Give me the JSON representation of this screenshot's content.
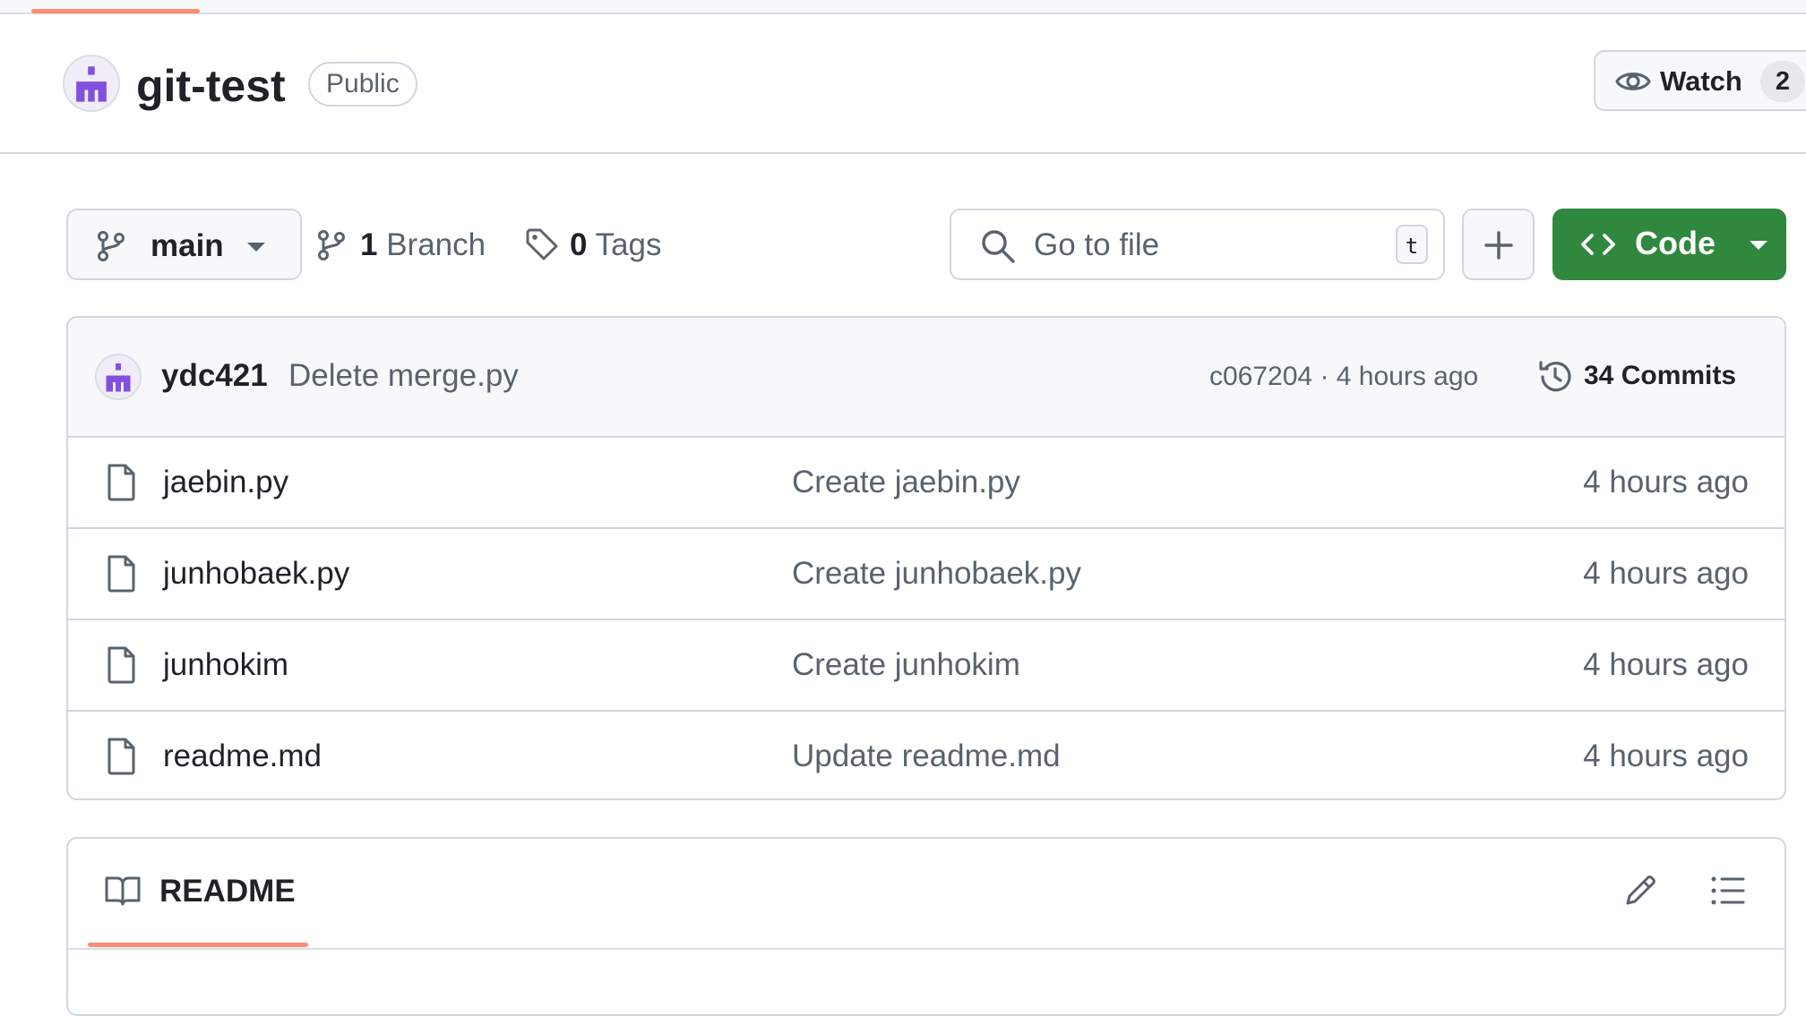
{
  "repo": {
    "name": "git-test",
    "visibility": "Public",
    "watch_label": "Watch",
    "watch_count": "2"
  },
  "toolbar": {
    "branch_name": "main",
    "branches_count": "1",
    "branches_label": "Branch",
    "tags_count": "0",
    "tags_label": "Tags",
    "search_placeholder": "Go to file",
    "search_shortcut": "t",
    "code_label": "Code"
  },
  "latest_commit": {
    "author": "ydc421",
    "message": "Delete merge.py",
    "sha_time": "c067204 · 4 hours ago",
    "commits_label": "34 Commits"
  },
  "files": [
    {
      "name": "jaebin.py",
      "commit_message": "Create jaebin.py",
      "age": "4 hours ago"
    },
    {
      "name": "junhobaek.py",
      "commit_message": "Create junhobaek.py",
      "age": "4 hours ago"
    },
    {
      "name": "junhokim",
      "commit_message": "Create junhokim",
      "age": "4 hours ago"
    },
    {
      "name": "readme.md",
      "commit_message": "Update readme.md",
      "age": "4 hours ago"
    }
  ],
  "readme": {
    "title": "README"
  },
  "colors": {
    "accent_underline": "#fd8c73",
    "code_button": "#2f883d",
    "avatar_purple": "#8250df"
  }
}
